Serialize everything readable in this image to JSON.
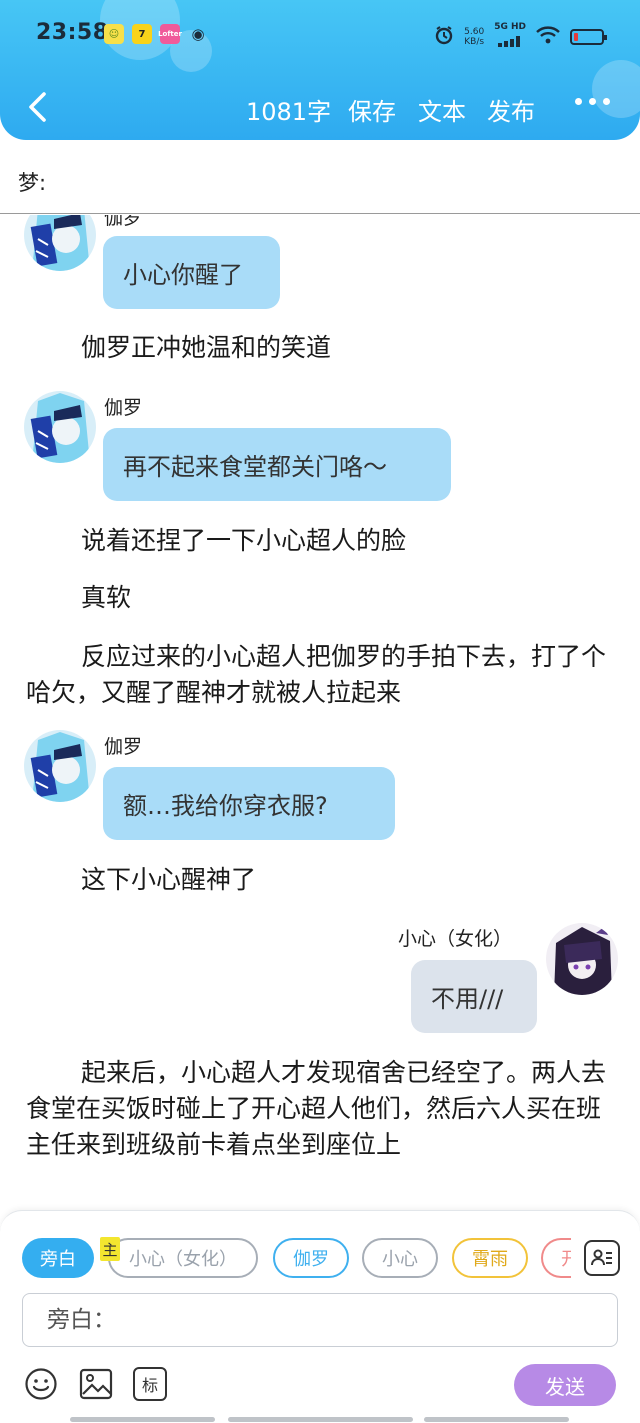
{
  "status_bar": {
    "time": "23:58",
    "net_speed_value": "5.60",
    "net_speed_unit": "KB/s",
    "network": "5G HD"
  },
  "toolbar": {
    "word_count": "1081字",
    "save_label": "保存",
    "text_label": "文本",
    "publish_label": "发布"
  },
  "dream": {
    "label": "梦:"
  },
  "chat": {
    "top_partial_name": "伽罗",
    "messages": [
      {
        "speaker": "伽罗",
        "text": "小心你醒了"
      },
      {
        "narration": "伽罗正冲她温和的笑道"
      },
      {
        "speaker": "伽罗",
        "text": "再不起来食堂都关门咯～"
      },
      {
        "narration": "说着还捏了一下小心超人的脸"
      },
      {
        "narration": "真软"
      },
      {
        "narration": "反应过来的小心超人把伽罗的手拍下去，打了个哈欠，又醒了醒神才就被人拉起来"
      },
      {
        "speaker": "伽罗",
        "text": "额…我给你穿衣服?"
      },
      {
        "narration": "这下小心醒神了"
      },
      {
        "speaker": "小心（女化）",
        "text": "不用///"
      },
      {
        "narration": "起来后，小心超人才发现宿舍已经空了。两人去食堂在买饭时碰上了开心超人他们，然后六人买在班主任来到班级前卡着点坐到座位上"
      }
    ]
  },
  "role_bar": {
    "roles": [
      "旁白",
      "小心（女化）",
      "伽罗",
      "小心",
      "霄雨",
      "开"
    ],
    "main_badge": "主"
  },
  "input": {
    "placeholder": "旁白："
  },
  "tools": {
    "mark_label": "标",
    "send_label": "发送"
  },
  "colors": {
    "header_blue": "#2eaaf0",
    "bubble_left": "#a9dcf8",
    "bubble_right": "#dce3ec",
    "send_purple": "#b78ae6",
    "chip_active": "#34aef0"
  },
  "icons": [
    "back-arrow-icon",
    "more-dots-icon",
    "alarm-icon",
    "wifi-icon",
    "signal-icon",
    "battery-icon",
    "contacts-icon",
    "emoji-icon",
    "image-icon"
  ],
  "battery_level": 0.15
}
